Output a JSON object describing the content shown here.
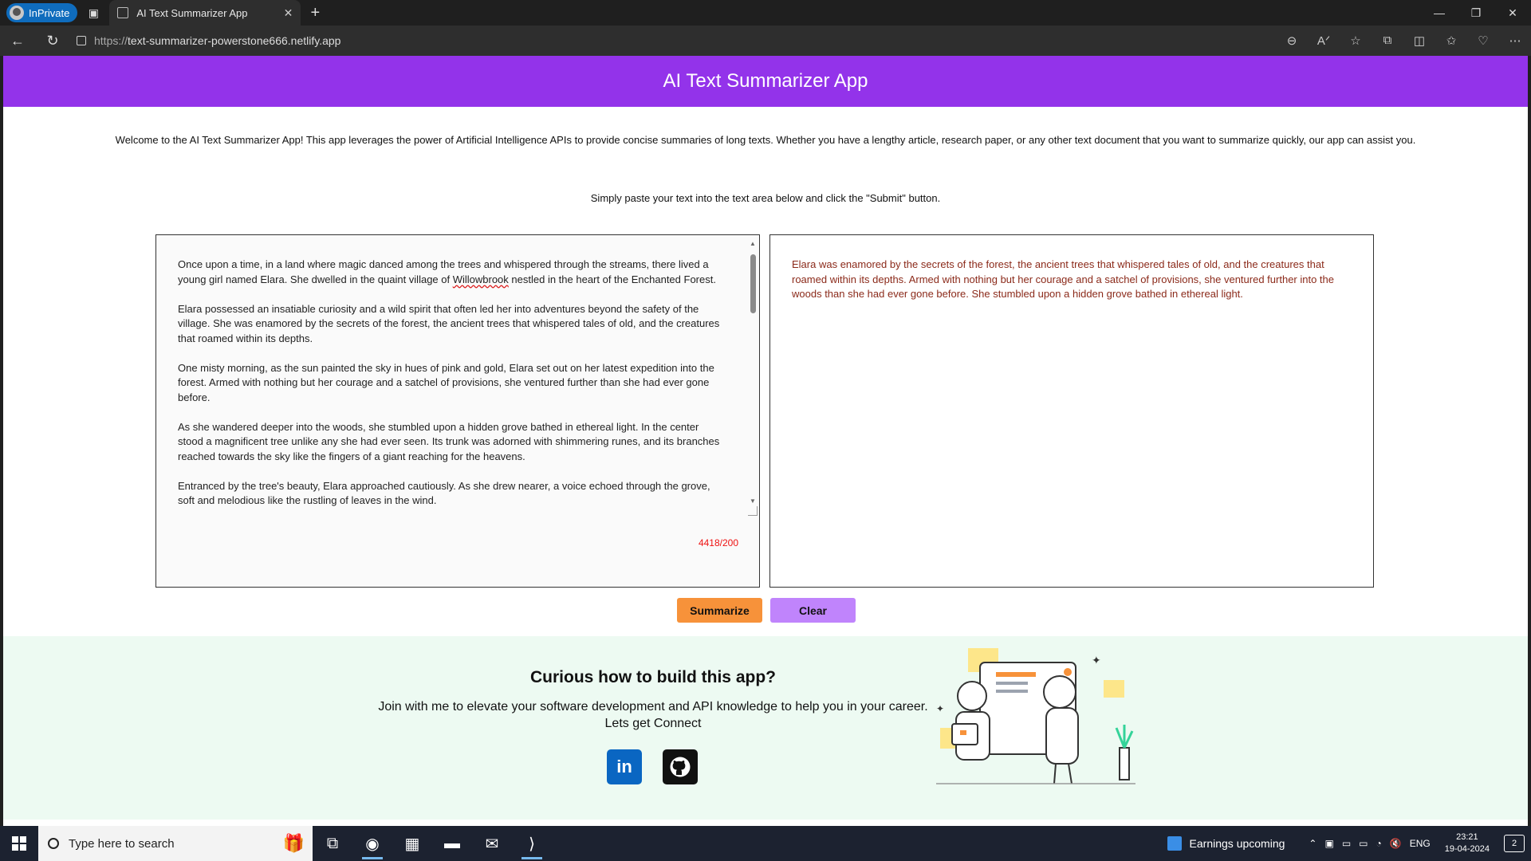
{
  "browser": {
    "inprivate_label": "InPrivate",
    "tab_title": "AI Text Summarizer App",
    "url_prefix": "https://",
    "url_host": "text-summarizer-powerstone666.netlify.app"
  },
  "app": {
    "header_title": "AI Text Summarizer App",
    "intro": "Welcome to the AI Text Summarizer App! This app leverages the power of Artificial Intelligence APIs to provide concise summaries of long texts. Whether you have a lengthy article, research paper, or any other text document that you want to summarize quickly, our app can assist you.",
    "instructions": "Simply paste your text into the text area below and click the \"Submit\" button.",
    "input_paragraphs": {
      "p1_a": "Once upon a time, in a land where magic danced among the trees and whispered through the streams, there lived a young girl named Elara. She dwelled in the quaint village of ",
      "p1_word": "Willowbrook",
      "p1_b": " nestled in the heart of the Enchanted Forest.",
      "p2": "Elara possessed an insatiable curiosity and a wild spirit that often led her into adventures beyond the safety of the village. She was enamored by the secrets of the forest, the ancient trees that whispered tales of old, and the creatures that roamed within its depths.",
      "p3": "One misty morning, as the sun painted the sky in hues of pink and gold, Elara set out on her latest expedition into the forest. Armed with nothing but her courage and a satchel of provisions, she ventured further than she had ever gone before.",
      "p4": "As she wandered deeper into the woods, she stumbled upon a hidden grove bathed in ethereal light. In the center stood a magnificent tree unlike any she had ever seen. Its trunk was adorned with shimmering runes, and its branches reached towards the sky like the fingers of a giant reaching for the heavens.",
      "p5": "Entranced by the tree's beauty, Elara approached cautiously. As she drew nearer, a voice echoed through the grove, soft and melodious like the rustling of leaves in the wind."
    },
    "char_counter": "4418/200",
    "summary": "Elara was enamored by the secrets of the forest, the ancient trees that whispered tales of old, and the creatures that roamed within its depths. Armed with nothing but her courage and a satchel of provisions, she ventured further into the woods than she had ever gone before. She stumbled upon a hidden grove bathed in ethereal light.",
    "summarize_label": "Summarize",
    "clear_label": "Clear"
  },
  "footer": {
    "heading": "Curious how to build this app?",
    "blurb": "Join with me to elevate your software development and API knowledge to help you in your career. Lets get Connect",
    "linkedin_glyph": "in"
  },
  "taskbar": {
    "search_placeholder": "Type here to search",
    "earnings": "Earnings upcoming",
    "lang": "ENG",
    "time": "23:21",
    "date": "19-04-2024",
    "notifications": "2"
  },
  "colors": {
    "header_purple": "#9333ea",
    "summarize_orange": "#f7923a",
    "clear_lavender": "#c084fc",
    "summary_text": "#8b2a1a",
    "counter_red": "#ee1111",
    "footer_bg": "#edfaf2"
  }
}
